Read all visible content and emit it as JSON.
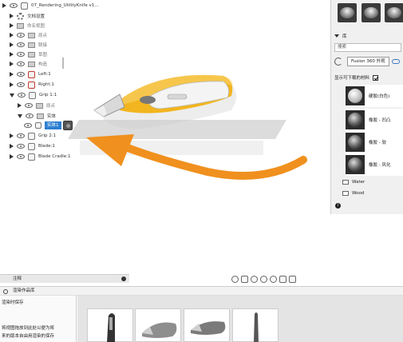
{
  "tree": {
    "root_label": "07_Rendering_UtilityKnife v1...",
    "doc_settings": "文档设置",
    "named_views": "命名视图",
    "origin": "原点",
    "joint_origins": "联接",
    "sketches": "草图",
    "construction": "构造",
    "left_label": "Left:1",
    "right_label": "Right:1",
    "grip11_label": "Grip 1:1",
    "grip_origin": "原点",
    "bodies": "实体",
    "body1": "实体1",
    "grip21_label": "Grip 2:1",
    "blade_label": "Blade:1",
    "blade_cradle_label": "Blade Cradle:1"
  },
  "right_panel": {
    "library_title": "库",
    "search_placeholder": "搜索",
    "tab_label": "Fusion 360 外观",
    "download_label": "显示可下载的材料",
    "materials": [
      "硬胶(白色)",
      "橡胶 - 凹凸",
      "橡胶 - 软",
      "橡胶 - 风化"
    ],
    "folders": [
      "Water",
      "Wood"
    ]
  },
  "bottom": {
    "search_bar_label": "注释",
    "gallery_title": "渲染作品库",
    "save_label": "渲染时保存",
    "hint_line1": "将视图拖放到此处以便为将",
    "hint_line2": "来的版本自由用渲染的保存"
  },
  "colors": {
    "accent_orange": "#f0901e",
    "selection_blue": "#2d7fd1",
    "knife_yellow": "#f2b51f"
  }
}
